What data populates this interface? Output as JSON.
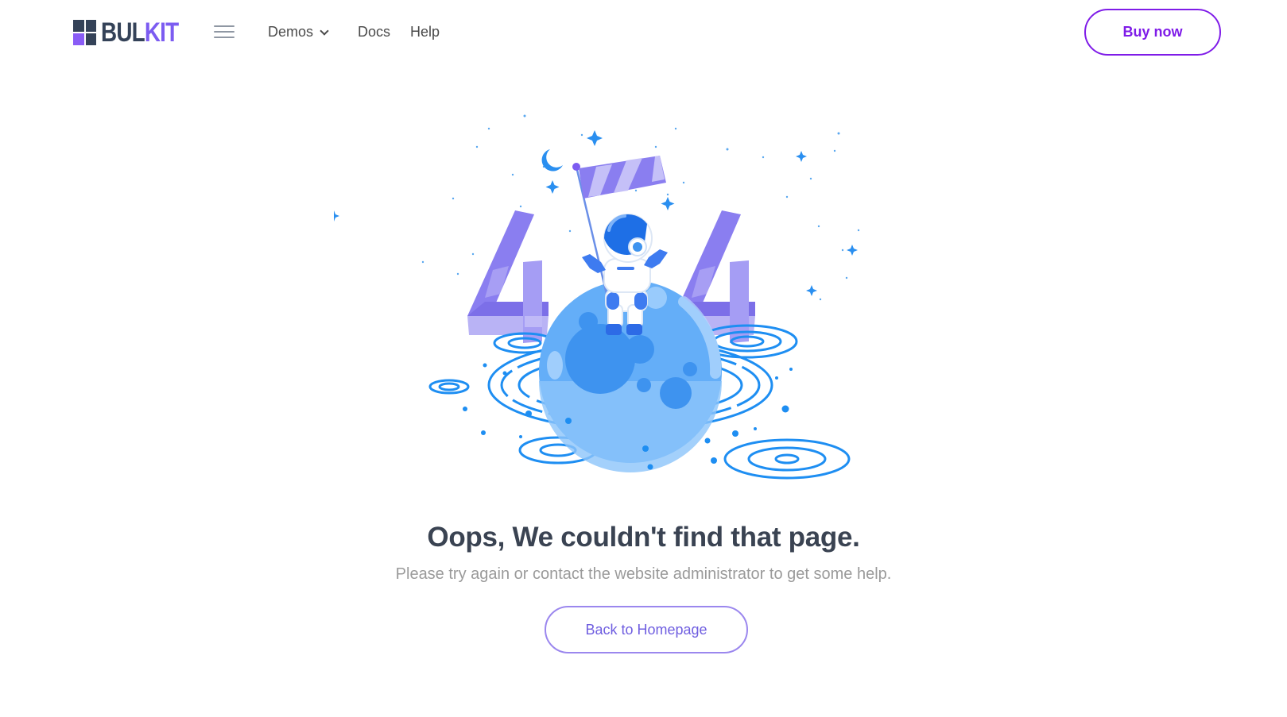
{
  "navbar": {
    "brand": {
      "part1": "BUL",
      "part2": "KIT"
    },
    "menu_icon": "hamburger-menu-icon",
    "items": [
      {
        "label": "Demos",
        "has_dropdown": true
      },
      {
        "label": "Docs"
      },
      {
        "label": "Help"
      }
    ],
    "cta_label": "Buy now"
  },
  "error": {
    "illustration": "astronaut-on-planet-404-illustration",
    "title": "Oops, We couldn't find that page.",
    "subtitle": "Please try again or contact the website administrator to get some help.",
    "home_button_label": "Back to Homepage"
  },
  "colors": {
    "primary": "#7f1ce8",
    "accent_purple": "#7c5cf1",
    "dark": "#344258",
    "illustration_blue": "#2196f3"
  }
}
